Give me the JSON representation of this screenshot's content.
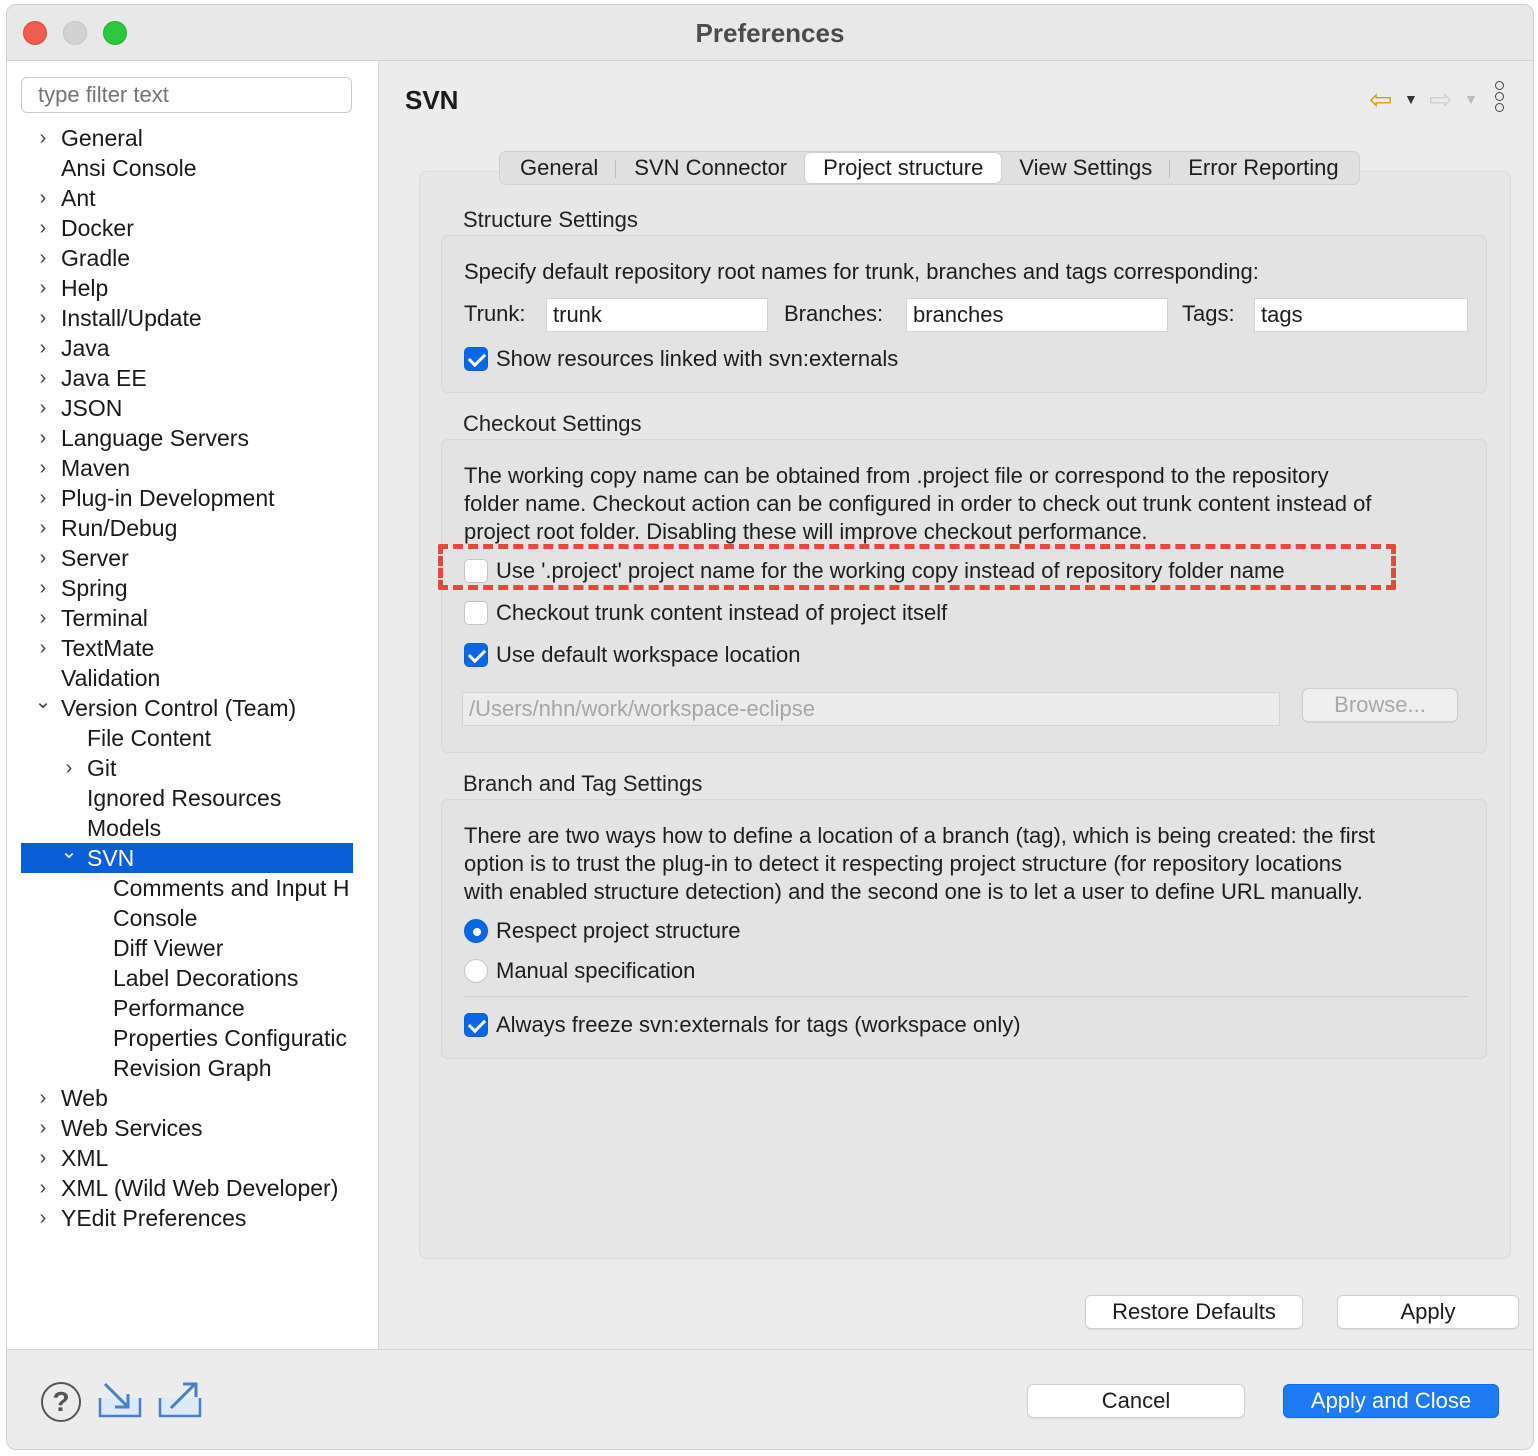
{
  "window": {
    "title": "Preferences"
  },
  "sidebar": {
    "filter_placeholder": "type filter text",
    "items": [
      {
        "label": "General",
        "level": 0,
        "expandable": true,
        "expanded": false
      },
      {
        "label": "Ansi Console",
        "level": 0,
        "expandable": false
      },
      {
        "label": "Ant",
        "level": 0,
        "expandable": true,
        "expanded": false
      },
      {
        "label": "Docker",
        "level": 0,
        "expandable": true,
        "expanded": false
      },
      {
        "label": "Gradle",
        "level": 0,
        "expandable": true,
        "expanded": false
      },
      {
        "label": "Help",
        "level": 0,
        "expandable": true,
        "expanded": false
      },
      {
        "label": "Install/Update",
        "level": 0,
        "expandable": true,
        "expanded": false
      },
      {
        "label": "Java",
        "level": 0,
        "expandable": true,
        "expanded": false
      },
      {
        "label": "Java EE",
        "level": 0,
        "expandable": true,
        "expanded": false
      },
      {
        "label": "JSON",
        "level": 0,
        "expandable": true,
        "expanded": false
      },
      {
        "label": "Language Servers",
        "level": 0,
        "expandable": true,
        "expanded": false
      },
      {
        "label": "Maven",
        "level": 0,
        "expandable": true,
        "expanded": false
      },
      {
        "label": "Plug-in Development",
        "level": 0,
        "expandable": true,
        "expanded": false
      },
      {
        "label": "Run/Debug",
        "level": 0,
        "expandable": true,
        "expanded": false
      },
      {
        "label": "Server",
        "level": 0,
        "expandable": true,
        "expanded": false
      },
      {
        "label": "Spring",
        "level": 0,
        "expandable": true,
        "expanded": false
      },
      {
        "label": "Terminal",
        "level": 0,
        "expandable": true,
        "expanded": false
      },
      {
        "label": "TextMate",
        "level": 0,
        "expandable": true,
        "expanded": false
      },
      {
        "label": "Validation",
        "level": 0,
        "expandable": false
      },
      {
        "label": "Version Control (Team)",
        "level": 0,
        "expandable": true,
        "expanded": true
      },
      {
        "label": "File Content",
        "level": 1,
        "expandable": false
      },
      {
        "label": "Git",
        "level": 1,
        "expandable": true,
        "expanded": false
      },
      {
        "label": "Ignored Resources",
        "level": 1,
        "expandable": false
      },
      {
        "label": "Models",
        "level": 1,
        "expandable": false
      },
      {
        "label": "SVN",
        "level": 1,
        "expandable": true,
        "expanded": true,
        "selected": true
      },
      {
        "label": "Comments and Input H",
        "level": 2,
        "expandable": false
      },
      {
        "label": "Console",
        "level": 2,
        "expandable": false
      },
      {
        "label": "Diff Viewer",
        "level": 2,
        "expandable": false
      },
      {
        "label": "Label Decorations",
        "level": 2,
        "expandable": false
      },
      {
        "label": "Performance",
        "level": 2,
        "expandable": false
      },
      {
        "label": "Properties Configuratic",
        "level": 2,
        "expandable": false
      },
      {
        "label": "Revision Graph",
        "level": 2,
        "expandable": false
      },
      {
        "label": "Web",
        "level": 0,
        "expandable": true,
        "expanded": false
      },
      {
        "label": "Web Services",
        "level": 0,
        "expandable": true,
        "expanded": false
      },
      {
        "label": "XML",
        "level": 0,
        "expandable": true,
        "expanded": false
      },
      {
        "label": "XML (Wild Web Developer)",
        "level": 0,
        "expandable": true,
        "expanded": false
      },
      {
        "label": "YEdit Preferences",
        "level": 0,
        "expandable": true,
        "expanded": false
      }
    ]
  },
  "main": {
    "title": "SVN",
    "nav": {
      "back_icon": "arrow-left-icon",
      "forward_icon": "arrow-right-icon",
      "menu_icon": "kebab-menu-icon"
    },
    "tabs": [
      "General",
      "SVN Connector",
      "Project structure",
      "View Settings",
      "Error Reporting"
    ],
    "active_tab": "Project structure",
    "structure": {
      "label": "Structure Settings",
      "description": "Specify default repository root names for trunk, branches and tags corresponding:",
      "trunk_label": "Trunk:",
      "trunk_value": "trunk",
      "branches_label": "Branches:",
      "branches_value": "branches",
      "tags_label": "Tags:",
      "tags_value": "tags",
      "show_externals": {
        "label": "Show resources linked with svn:externals",
        "checked": true
      }
    },
    "checkout": {
      "label": "Checkout Settings",
      "description_1": "The working copy name can be obtained from .project file or correspond to the repository",
      "description_2": "folder name. Checkout action can be configured in order to check out trunk content instead of",
      "description_3": "project root folder. Disabling these will improve checkout performance.",
      "use_project_name": {
        "label": "Use '.project' project name for the working copy instead of repository folder name",
        "checked": false
      },
      "checkout_trunk": {
        "label": "Checkout trunk content instead of project itself",
        "checked": false
      },
      "use_default_location": {
        "label": "Use default workspace location",
        "checked": true
      },
      "location_value": "/Users/nhn/work/workspace-eclipse",
      "browse_label": "Browse..."
    },
    "branch_tag": {
      "label": "Branch and Tag Settings",
      "description_1": "There are two ways how to define a location of a branch (tag), which is being created: the first",
      "description_2": "option is to trust the plug-in to detect it respecting project structure (for repository locations",
      "description_3": "with enabled structure detection) and the second one is to let a user to define URL manually.",
      "respect_structure": {
        "label": "Respect project structure",
        "selected": true
      },
      "manual_spec": {
        "label": "Manual specification",
        "selected": false
      },
      "freeze_externals": {
        "label": "Always freeze svn:externals for tags (workspace only)",
        "checked": true
      }
    },
    "restore_defaults_label": "Restore Defaults",
    "apply_label": "Apply"
  },
  "footer": {
    "help_icon": "help-icon",
    "import_icon": "import-icon",
    "export_icon": "export-icon",
    "cancel_label": "Cancel",
    "apply_close_label": "Apply and Close"
  },
  "colors": {
    "accent": "#0a66e4",
    "selection": "#0a5fd8",
    "highlight": "#e8473c"
  }
}
